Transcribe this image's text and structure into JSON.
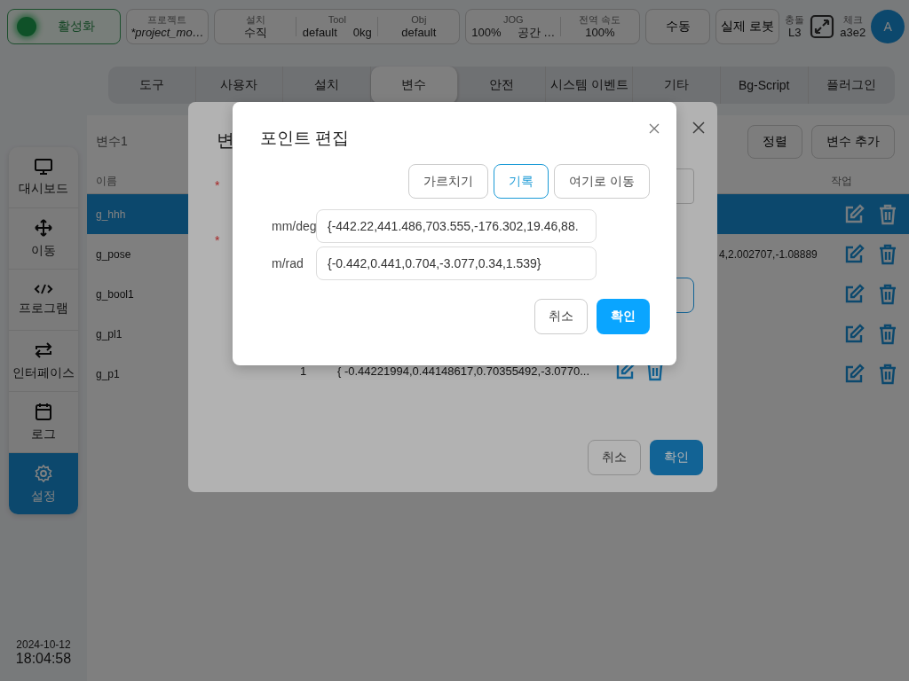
{
  "top_bar": {
    "activate_button": {
      "label": "활성화",
      "on": true
    },
    "project": {
      "label": "프로젝트",
      "value": "*project_mo…"
    },
    "install_group": [
      {
        "label": "설치",
        "values": [
          "수직"
        ]
      },
      {
        "label": "Tool",
        "values": [
          "default",
          "0kg"
        ]
      },
      {
        "label": "Obj",
        "values": [
          "default"
        ]
      }
    ],
    "jog_group": [
      {
        "label": "JOG",
        "values": [
          "100%",
          "공간 …"
        ]
      },
      {
        "label": "전역 속도",
        "values": [
          "100%"
        ]
      }
    ],
    "mode_button": "수동",
    "robot_button": "실제 로봇",
    "collision": {
      "label": "충돌",
      "value": "L3"
    },
    "check": {
      "label": "체크",
      "value": "a3e2"
    },
    "avatar": "A"
  },
  "sidebar": {
    "items": [
      {
        "label": "대시보드",
        "kind": "monitor",
        "selected": false
      },
      {
        "label": "이동",
        "kind": "move",
        "selected": false
      },
      {
        "label": "프로그램",
        "kind": "code",
        "selected": false
      },
      {
        "label": "인터페이스",
        "kind": "swap",
        "selected": false
      },
      {
        "label": "로그",
        "kind": "calendar",
        "selected": false
      },
      {
        "label": "설정",
        "kind": "gear",
        "selected": true
      }
    ],
    "date": "2024-10-12",
    "time": "18:04:58"
  },
  "tabs": [
    {
      "label": "도구",
      "selected": false
    },
    {
      "label": "사용자",
      "selected": false
    },
    {
      "label": "설치",
      "selected": false
    },
    {
      "label": "변수",
      "selected": true
    },
    {
      "label": "안전",
      "selected": false
    },
    {
      "label": "시스템 이벤트",
      "selected": false
    },
    {
      "label": "기타",
      "selected": false
    },
    {
      "label": "Bg-Script",
      "selected": false
    },
    {
      "label": "플러그인",
      "selected": false
    }
  ],
  "variables": {
    "title": "변수1",
    "buttons": [
      "정렬",
      "변수 추가"
    ],
    "columns": [
      "이름",
      "작업"
    ],
    "rows": [
      {
        "name": "g_hhh",
        "selected": true
      },
      {
        "name": "g_pose",
        "value": "4,2.002707,-1.08889",
        "selected": false
      },
      {
        "name": "g_bool1",
        "selected": false
      },
      {
        "name": "g_pl1",
        "selected": false
      },
      {
        "name": "g_p1",
        "selected": false
      }
    ]
  },
  "variable_dialog": {
    "title": "변",
    "required_marks": [
      "*",
      "*"
    ],
    "row": {
      "index": "1",
      "value": "{ -0.44221994,0.44148617,0.70355492,-3.0770..."
    },
    "buttons": {
      "cancel": "취소",
      "ok": "확인"
    }
  },
  "point_dialog": {
    "title": "포인트 편집",
    "modes": [
      {
        "label": "가르치기",
        "selected": false
      },
      {
        "label": "기록",
        "selected": true
      },
      {
        "label": "여기로 이동",
        "selected": false
      }
    ],
    "fields": [
      {
        "label": "mm/deg",
        "value": "{-442.22,441.486,703.555,-176.302,19.46,88."
      },
      {
        "label": "m/rad",
        "value": "{-0.442,0.441,0.704,-3.077,0.34,1.539}"
      }
    ],
    "buttons": {
      "cancel": "취소",
      "ok": "확인"
    }
  }
}
